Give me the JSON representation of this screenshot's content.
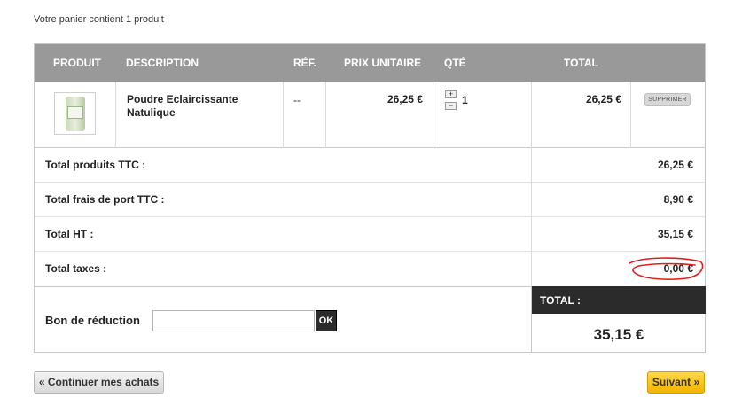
{
  "cart_summary": "Votre panier contient 1 produit",
  "table_header": {
    "product": "PRODUIT",
    "description": "DESCRIPTION",
    "ref": "RÉF.",
    "unit_price": "PRIX UNITAIRE",
    "qty": "QTÉ",
    "total": "TOTAL"
  },
  "item": {
    "name_line1": "Poudre Eclaircissante",
    "name_line2": "Natulique",
    "ref": "--",
    "unit_price": "26,25 €",
    "qty_plus": "+",
    "qty_minus": "−",
    "qty": "1",
    "total": "26,25 €",
    "remove_label": "SUPPRIMER"
  },
  "totals": [
    {
      "label": "Total produits TTC :",
      "value": "26,25 €"
    },
    {
      "label": "Total frais de port TTC :",
      "value": "8,90 €"
    },
    {
      "label": "Total HT :",
      "value": "35,15 €"
    },
    {
      "label": "Total taxes :",
      "value": "0,00 €"
    }
  ],
  "coupon": {
    "label": "Bon de réduction",
    "value": "",
    "button": "OK"
  },
  "grand_total": {
    "label": "TOTAL :",
    "value": "35,15 €"
  },
  "buttons": {
    "continue": "« Continuer mes achats",
    "next": "Suivant »"
  },
  "colors": {
    "header_bg": "#999999",
    "grand_total_bg": "#2b2b2b",
    "next_button": "#f2b400",
    "annotation": "#e02020"
  }
}
